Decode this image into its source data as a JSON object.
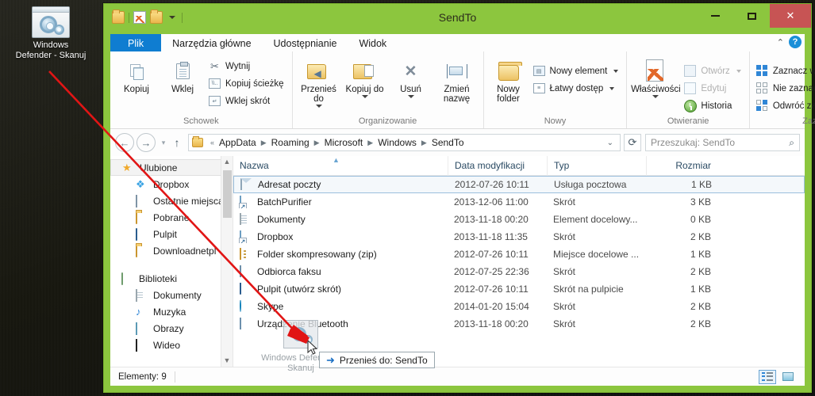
{
  "desktop": {
    "icon": {
      "label": "Windows Defender - Skanuj",
      "icon": "defender-gears-icon"
    }
  },
  "window": {
    "title": "SendTo",
    "quick_access": [
      "folder-icon",
      "properties-icon",
      "new-folder-icon",
      "chevron-down-icon"
    ],
    "controls": {
      "minimize": "–",
      "maximize": "□",
      "close": "✕"
    },
    "accent_color": "#8cc63e",
    "close_color": "#c75454"
  },
  "tabs": [
    {
      "label": "Plik",
      "type": "file"
    },
    {
      "label": "Narzędzia główne",
      "type": "active"
    },
    {
      "label": "Udostępnianie",
      "type": "plain"
    },
    {
      "label": "Widok",
      "type": "plain"
    }
  ],
  "ribbon": {
    "collapse_label": "⌃",
    "help_label": "?",
    "groups": [
      {
        "title": "Schowek",
        "big": [
          {
            "label": "Kopiuj",
            "icon": "copy-icon"
          },
          {
            "label": "Wklej",
            "icon": "paste-icon"
          }
        ],
        "small": [
          {
            "label": "Wytnij",
            "icon": "scissors-icon"
          },
          {
            "label": "Kopiuj ścieżkę",
            "icon": "copy-path-icon"
          },
          {
            "label": "Wklej skrót",
            "icon": "paste-shortcut-icon"
          }
        ]
      },
      {
        "title": "Organizowanie",
        "big": [
          {
            "label": "Przenieś do",
            "icon": "move-to-icon",
            "dropdown": true
          },
          {
            "label": "Kopiuj do",
            "icon": "copy-to-icon",
            "dropdown": true
          },
          {
            "label": "Usuń",
            "icon": "delete-icon",
            "dropdown": true
          },
          {
            "label": "Zmień nazwę",
            "icon": "rename-icon"
          }
        ],
        "small": []
      },
      {
        "title": "Nowy",
        "big": [
          {
            "label": "Nowy folder",
            "icon": "new-folder-icon"
          }
        ],
        "small": [
          {
            "label": "Nowy element",
            "icon": "new-item-icon",
            "dropdown": true
          },
          {
            "label": "Łatwy dostęp",
            "icon": "easy-access-icon",
            "dropdown": true
          }
        ]
      },
      {
        "title": "Otwieranie",
        "big": [
          {
            "label": "Właściwości",
            "icon": "properties-icon",
            "dropdown": true
          }
        ],
        "small": [
          {
            "label": "Otwórz",
            "icon": "open-icon",
            "dropdown": true,
            "disabled": true
          },
          {
            "label": "Edytuj",
            "icon": "edit-icon",
            "disabled": true
          },
          {
            "label": "Historia",
            "icon": "history-icon"
          }
        ]
      },
      {
        "title": "Zaznaczanie",
        "big": [],
        "small": [
          {
            "label": "Zaznacz wszystko",
            "icon": "select-all-icon"
          },
          {
            "label": "Nie zaznaczaj nic",
            "icon": "select-none-icon"
          },
          {
            "label": "Odwróć zaznaczenie",
            "icon": "invert-selection-icon"
          }
        ]
      }
    ]
  },
  "address": {
    "back_icon": "back-arrow-icon",
    "forward_icon": "forward-arrow-icon",
    "recent_icon": "chevron-down-icon",
    "up_icon": "up-arrow-icon",
    "breadcrumb_prefix": "«",
    "breadcrumb": [
      "AppData",
      "Roaming",
      "Microsoft",
      "Windows",
      "SendTo"
    ],
    "dropdown_icon": "chevron-down-icon",
    "refresh_icon": "refresh-icon",
    "search_placeholder": "Przeszukaj: SendTo",
    "search_value": "",
    "search_icon": "search-icon"
  },
  "navpane": {
    "items": [
      {
        "label": "Ulubione",
        "icon": "star-icon",
        "level": 0,
        "selected": true
      },
      {
        "label": "Dropbox",
        "icon": "dropbox-icon",
        "level": 1
      },
      {
        "label": "Ostatnie miejsca",
        "icon": "recent-places-icon",
        "level": 1
      },
      {
        "label": "Pobrane",
        "icon": "downloads-folder-icon",
        "level": 1
      },
      {
        "label": "Pulpit",
        "icon": "desktop-icon",
        "level": 1
      },
      {
        "label": "Downloadnetpl",
        "icon": "folder-icon",
        "level": 1
      },
      {
        "label": "Biblioteki",
        "icon": "libraries-icon",
        "level": 0
      },
      {
        "label": "Dokumenty",
        "icon": "documents-icon",
        "level": 1
      },
      {
        "label": "Muzyka",
        "icon": "music-icon",
        "level": 1
      },
      {
        "label": "Obrazy",
        "icon": "pictures-icon",
        "level": 1
      },
      {
        "label": "Wideo",
        "icon": "video-icon",
        "level": 1
      }
    ],
    "scroll_up_icon": "chevron-up-icon",
    "scroll_down_icon": "chevron-down-icon"
  },
  "filelist": {
    "columns": [
      "Nazwa",
      "Data modyfikacji",
      "Typ",
      "Rozmiar"
    ],
    "sort_indicator": "▲",
    "rows": [
      {
        "name": "Adresat poczty",
        "date": "2012-07-26 10:11",
        "type": "Usługa pocztowa",
        "size": "1 KB",
        "icon": "mail-recipient-icon",
        "selected": true
      },
      {
        "name": "BatchPurifier",
        "date": "2013-12-06 11:00",
        "type": "Skrót",
        "size": "3 KB",
        "icon": "shortcut-icon"
      },
      {
        "name": "Dokumenty",
        "date": "2013-11-18 00:20",
        "type": "Element docelowy...",
        "size": "0 KB",
        "icon": "document-icon"
      },
      {
        "name": "Dropbox",
        "date": "2013-11-18 11:35",
        "type": "Skrót",
        "size": "2 KB",
        "icon": "shortcut-icon"
      },
      {
        "name": "Folder skompresowany (zip)",
        "date": "2012-07-26 10:11",
        "type": "Miejsce docelowe ...",
        "size": "1 KB",
        "icon": "zip-folder-icon"
      },
      {
        "name": "Odbiorca faksu",
        "date": "2012-07-25 22:36",
        "type": "Skrót",
        "size": "2 KB",
        "icon": "fax-icon"
      },
      {
        "name": "Pulpit (utwórz skrót)",
        "date": "2012-07-26 10:11",
        "type": "Skrót na pulpicie",
        "size": "1 KB",
        "icon": "desktop-icon"
      },
      {
        "name": "Skype",
        "date": "2014-01-20 15:04",
        "type": "Skrót",
        "size": "2 KB",
        "icon": "skype-icon"
      },
      {
        "name": "Urządzenie Bluetooth",
        "date": "2013-11-18 00:20",
        "type": "Skrót",
        "size": "2 KB",
        "icon": "bluetooth-icon"
      }
    ]
  },
  "drag": {
    "ghost_label": "Windows Defender - Skanuj",
    "tooltip": "Przenieś do: SendTo",
    "tooltip_icon": "move-arrow-icon",
    "cursor_icon": "arrow-cursor-icon"
  },
  "statusbar": {
    "item_count": "Elementy: 9",
    "view_buttons": [
      {
        "name": "details-view",
        "icon": "details-view-icon",
        "active": true
      },
      {
        "name": "large-icons-view",
        "icon": "large-icons-view-icon",
        "active": false
      }
    ]
  },
  "annotation": {
    "arrow_color": "#e11515"
  }
}
